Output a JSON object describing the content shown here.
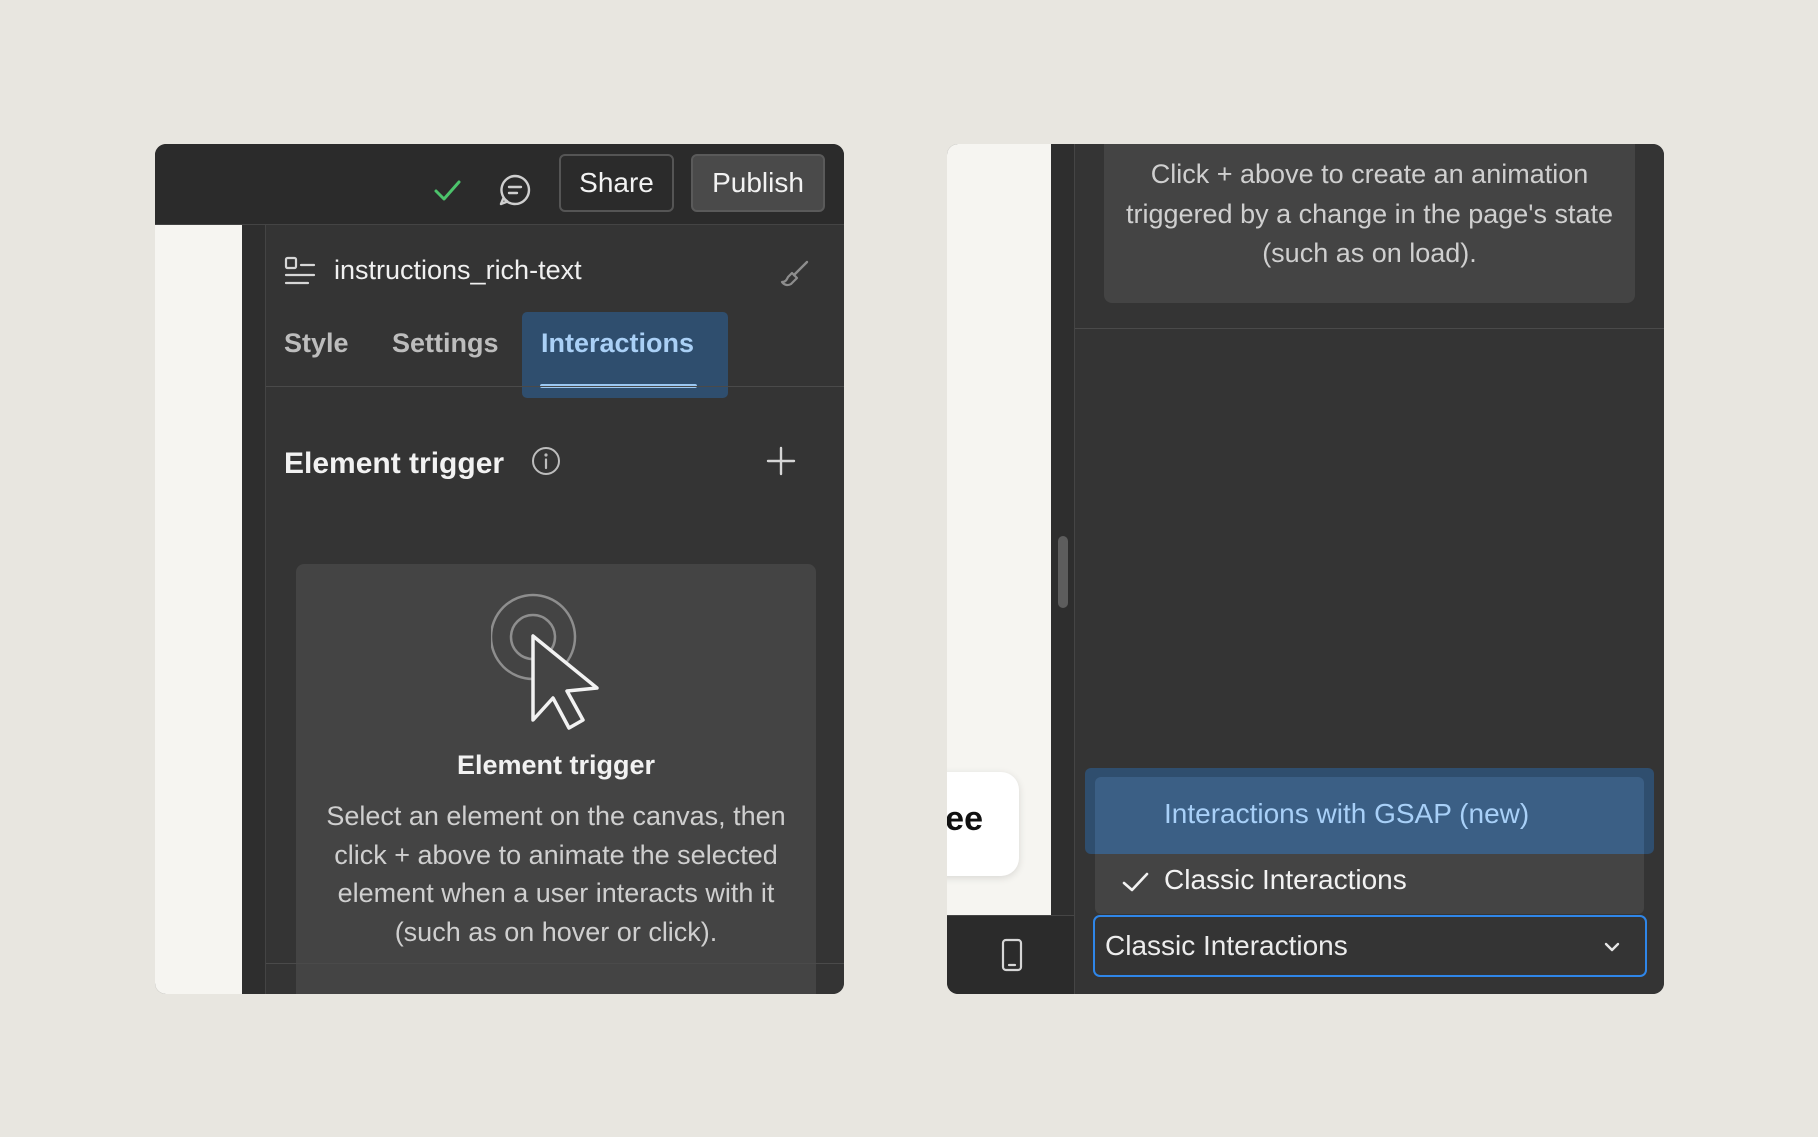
{
  "topbar": {
    "share_label": "Share",
    "publish_label": "Publish"
  },
  "panel": {
    "element_name": "instructions_rich-text",
    "tabs": [
      {
        "label": "Style",
        "active": false
      },
      {
        "label": "Settings",
        "active": false
      },
      {
        "label": "Interactions",
        "active": true
      }
    ],
    "element_trigger": {
      "section_title": "Element trigger",
      "empty_title": "Element trigger",
      "empty_description": "Select an element on the canvas, then click + above to animate the selected element when a user interacts with it (such as on hover or click)."
    }
  },
  "page_trigger": {
    "empty_description": "Click + above to create an animation triggered by a change in the page's state (such as on load)."
  },
  "canvas": {
    "floating_text": "ee"
  },
  "interactions_mode": {
    "options": [
      {
        "label": "Interactions with GSAP (new)",
        "highlighted": true,
        "selected": false
      },
      {
        "label": "Classic Interactions",
        "highlighted": false,
        "selected": true
      }
    ],
    "selected_value": "Classic Interactions"
  },
  "colors": {
    "accent": "#2f86e8",
    "active_tab_text": "#aad0f6",
    "highlight_bg": "#3b5f85",
    "saved_check": "#4cc36b",
    "panel_bg": "#343434",
    "page_bg": "#e8e6e0"
  },
  "icons": [
    "check-icon",
    "comment-icon",
    "rich-text-icon",
    "brush-icon",
    "info-icon",
    "plus-icon",
    "cursor-click-icon",
    "mobile-device-icon",
    "chevron-down-icon"
  ]
}
